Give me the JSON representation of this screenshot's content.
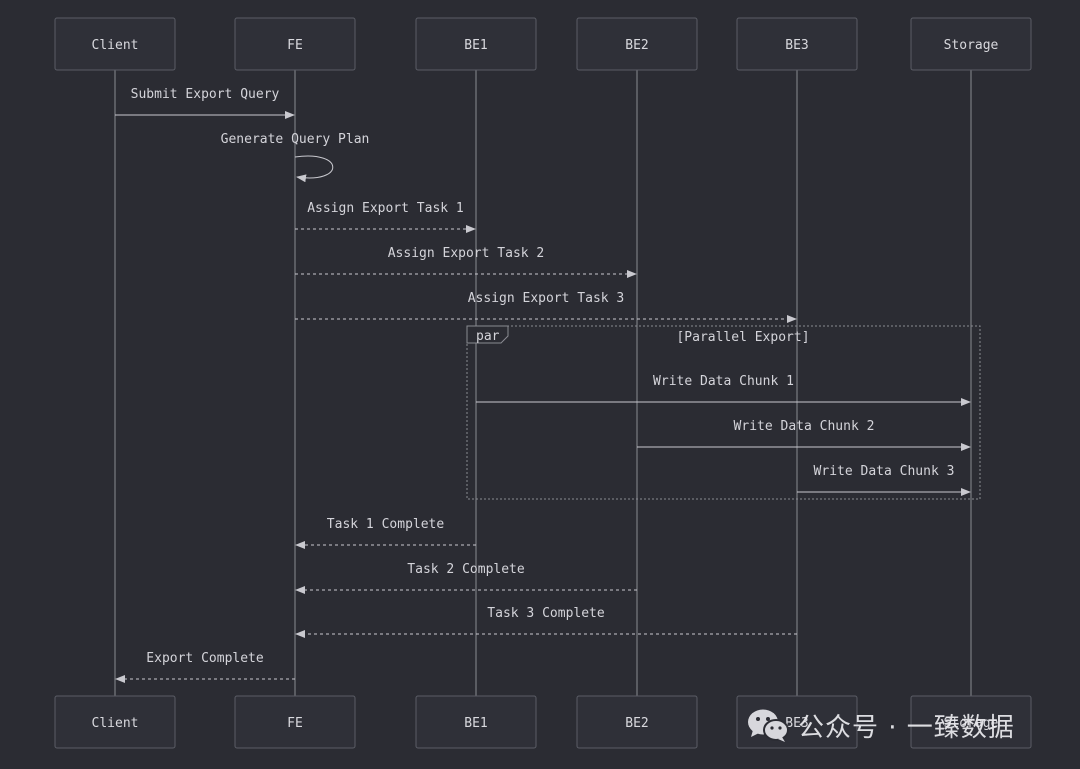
{
  "participants": [
    {
      "id": "client",
      "label": "Client"
    },
    {
      "id": "fe",
      "label": "FE"
    },
    {
      "id": "be1",
      "label": "BE1"
    },
    {
      "id": "be2",
      "label": "BE2"
    },
    {
      "id": "be3",
      "label": "BE3"
    },
    {
      "id": "storage",
      "label": "Storage"
    }
  ],
  "messages": [
    {
      "from": "client",
      "to": "fe",
      "text": "Submit Export Query",
      "style": "solid"
    },
    {
      "from": "fe",
      "to": "fe",
      "text": "Generate Query Plan",
      "style": "solid"
    },
    {
      "from": "fe",
      "to": "be1",
      "text": "Assign Export Task 1",
      "style": "dashed"
    },
    {
      "from": "fe",
      "to": "be2",
      "text": "Assign Export Task 2",
      "style": "dashed"
    },
    {
      "from": "fe",
      "to": "be3",
      "text": "Assign Export Task 3",
      "style": "dashed"
    },
    {
      "from": "be1",
      "to": "storage",
      "text": "Write Data Chunk 1",
      "style": "solid"
    },
    {
      "from": "be2",
      "to": "storage",
      "text": "Write Data Chunk 2",
      "style": "solid"
    },
    {
      "from": "be3",
      "to": "storage",
      "text": "Write Data Chunk 3",
      "style": "solid"
    },
    {
      "from": "be1",
      "to": "fe",
      "text": "Task 1 Complete",
      "style": "dashed"
    },
    {
      "from": "be2",
      "to": "fe",
      "text": "Task 2 Complete",
      "style": "dashed"
    },
    {
      "from": "be3",
      "to": "fe",
      "text": "Task 3 Complete",
      "style": "dashed"
    },
    {
      "from": "fe",
      "to": "client",
      "text": "Export Complete",
      "style": "dashed"
    }
  ],
  "par_frame": {
    "tag": "par",
    "label": "[Parallel Export]"
  },
  "watermark": {
    "text": "公众号 · 一臻数据",
    "icon": "wechat-icon"
  },
  "colors": {
    "background": "#2b2c33",
    "actor_fill": "#2f3038",
    "actor_stroke": "#5b5d66",
    "line": "#c9c9cf",
    "text": "#d4d4da"
  }
}
